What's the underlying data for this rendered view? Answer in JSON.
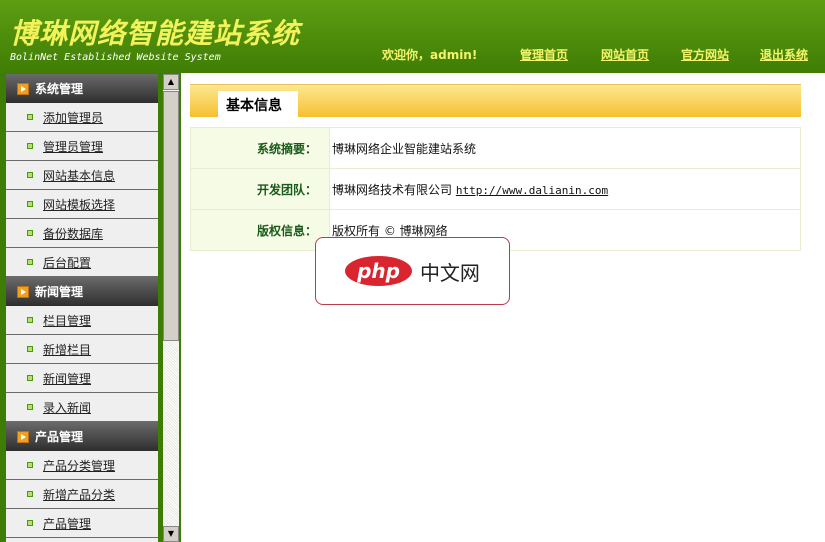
{
  "header": {
    "title": "博琳网络智能建站系统",
    "subtitle": "BolinNet Established Website System",
    "welcome": "欢迎你，admin!",
    "links": [
      "管理首页",
      "网站首页",
      "官方网站",
      "退出系统"
    ]
  },
  "sidebar": {
    "sections": [
      {
        "title": "系统管理",
        "items": [
          "添加管理员",
          "管理员管理",
          "网站基本信息",
          "网站模板选择",
          "备份数据库",
          "后台配置"
        ]
      },
      {
        "title": "新闻管理",
        "items": [
          "栏目管理",
          "新增栏目",
          "新闻管理",
          "录入新闻"
        ]
      },
      {
        "title": "产品管理",
        "items": [
          "产品分类管理",
          "新增产品分类",
          "产品管理"
        ]
      }
    ]
  },
  "main": {
    "tab": "基本信息",
    "rows": [
      {
        "label": "系统摘要：",
        "value": "博琳网络企业智能建站系统"
      },
      {
        "label": "开发团队：",
        "value": "博琳网络技术有限公司",
        "link": "http://www.dalianin.com"
      },
      {
        "label": "版权信息：",
        "value": "版权所有 © 博琳网络"
      }
    ]
  },
  "watermark": {
    "logo": "php",
    "text": "中文网"
  }
}
